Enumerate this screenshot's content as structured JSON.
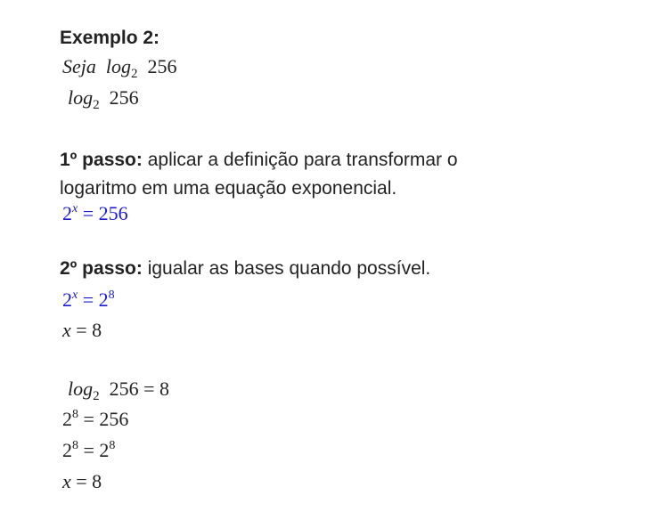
{
  "heading": "Exemplo 2:",
  "intro": {
    "seja": "Seja",
    "log": "log",
    "base": "2",
    "arg": "256"
  },
  "expr2": {
    "log": "log",
    "base": "2",
    "arg": "256"
  },
  "step1": {
    "label": "1º passo:",
    "text_line1": " aplicar a definição para transformar o",
    "text_line2": "logaritmo em uma equação exponencial.",
    "eq": {
      "base": "2",
      "exp": "x",
      "rhs": "= 256"
    }
  },
  "step2": {
    "label": "2º passo:",
    "text": " igualar as bases quando possível.",
    "eq1": {
      "base": "2",
      "exp": "x",
      "eq": "= 2",
      "exp2": "8"
    },
    "eq2": {
      "var": "x",
      "rhs": "= 8"
    }
  },
  "summary": {
    "line1": {
      "log": "log",
      "base": "2",
      "rest": "256 =  8"
    },
    "line2": {
      "base": "2",
      "exp": "8",
      "rhs": "= 256"
    },
    "line3": {
      "base": "2",
      "exp": "8",
      "eq": "= 2",
      "exp2": "8"
    },
    "line4": {
      "var": "x",
      "rhs": "= 8"
    }
  },
  "colors": {
    "text": "#222222",
    "equation_blue": "#1a1ad6"
  }
}
